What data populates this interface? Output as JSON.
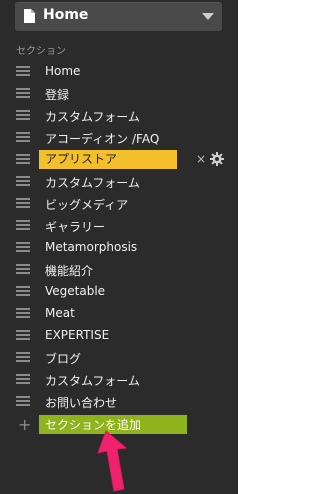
{
  "page_select": {
    "title": "Home",
    "icon": "document-icon",
    "chevron_icon": "chevron-down-icon"
  },
  "sections": {
    "header": "セクション",
    "items": [
      {
        "label": "Home"
      },
      {
        "label": "登録"
      },
      {
        "label": "カスタムフォーム"
      },
      {
        "label": "アコーディオン /FAQ"
      },
      {
        "label": "アプリストア",
        "active": true
      },
      {
        "label": "カスタムフォーム"
      },
      {
        "label": "ビッグメディア"
      },
      {
        "label": "ギャラリー"
      },
      {
        "label": "Metamorphosis"
      },
      {
        "label": "機能紹介"
      },
      {
        "label": "Vegetable"
      },
      {
        "label": "Meat"
      },
      {
        "label": "EXPERTISE"
      },
      {
        "label": "ブログ"
      },
      {
        "label": "カスタムフォーム"
      },
      {
        "label": "お問い合わせ"
      }
    ],
    "active_close_symbol": "×",
    "add_label": "セクションを追加",
    "add_icon": "+"
  },
  "colors": {
    "panel_bg": "#2b2b2b",
    "active_highlight": "#f3c02c",
    "add_button": "#8fb31d",
    "annotation_arrow": "#f0226b"
  }
}
